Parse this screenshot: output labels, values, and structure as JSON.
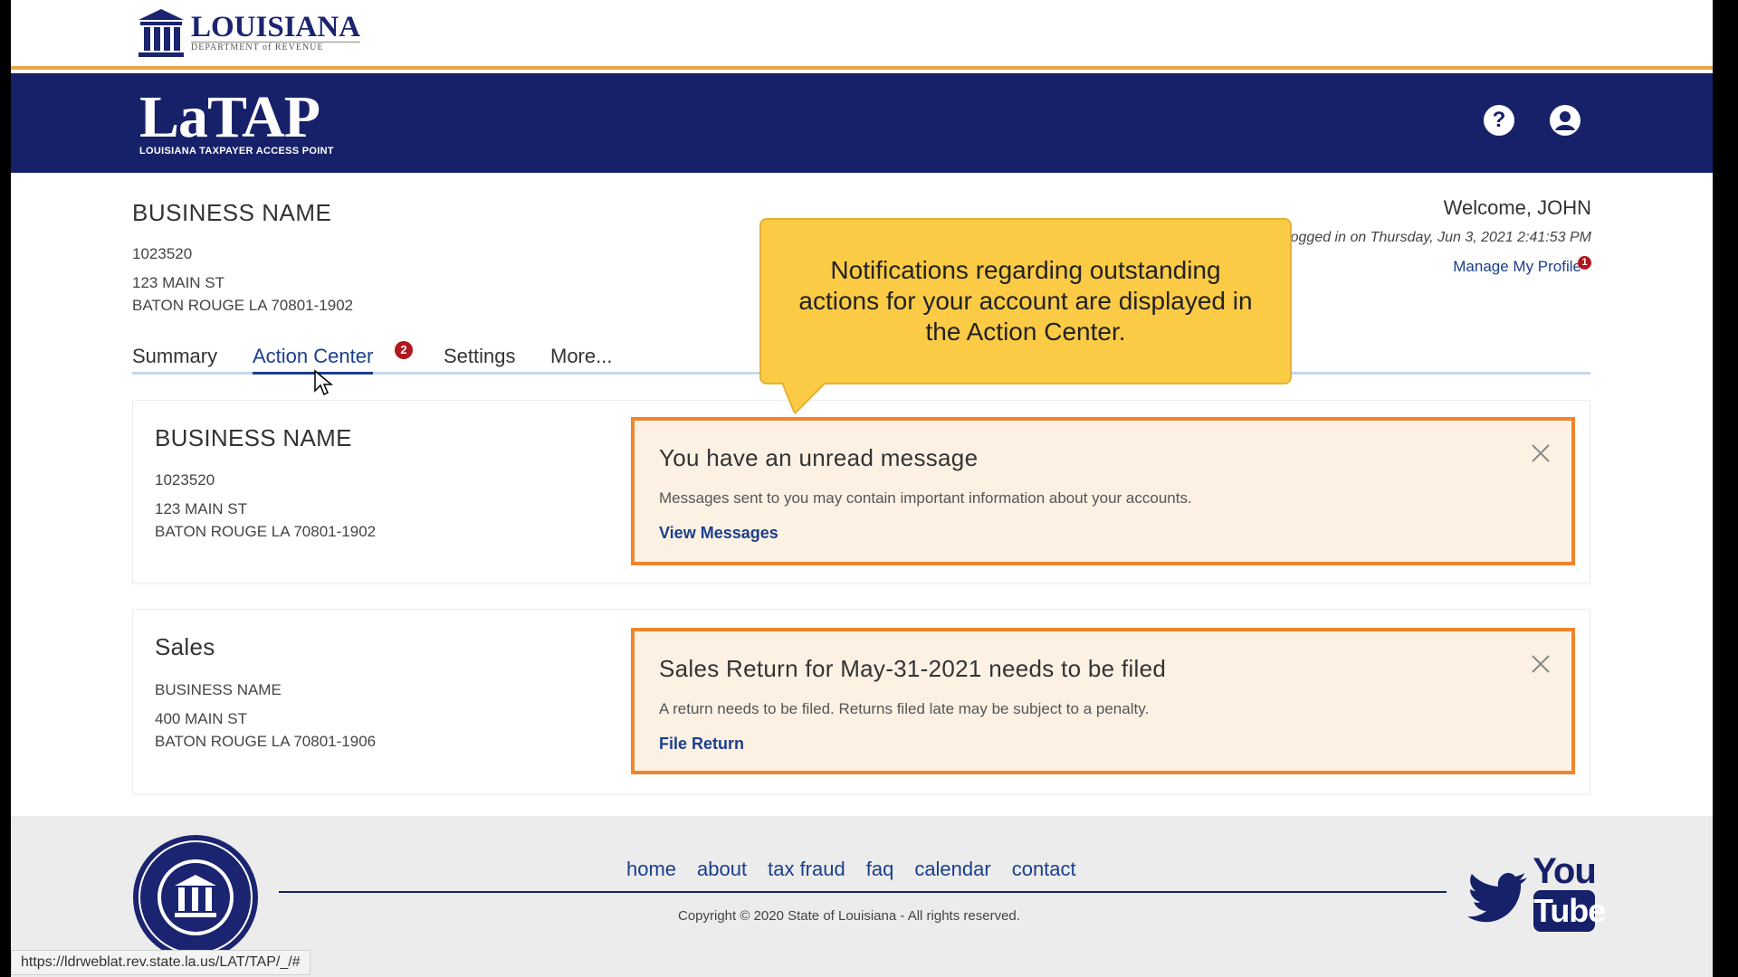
{
  "brand": {
    "dept_logo_word": "LOUISIANA",
    "dept_logo_sub": "DEPARTMENT of REVENUE",
    "app_logo": "LaTAP",
    "app_logo_sub": "LOUISIANA TAXPAYER ACCESS POINT",
    "colors": {
      "navy": "#16216a",
      "accent": "#f0852d",
      "callout": "#fbcb45",
      "link": "#1a3f8c",
      "badge": "#b0171f"
    }
  },
  "header": {
    "help_icon": "question-circle-icon",
    "user_icon": "user-circle-icon"
  },
  "business": {
    "name": "BUSINESS NAME",
    "id": "1023520",
    "address1": "123 MAIN ST",
    "address2": "BATON ROUGE LA 70801-1902"
  },
  "welcome": {
    "greeting": "Welcome, JOHN",
    "last_login": "logged in on Thursday, Jun 3, 2021 2:41:53 PM",
    "manage_profile": "Manage My Profile",
    "manage_badge": "1"
  },
  "tabs": [
    {
      "label": "Summary"
    },
    {
      "label": "Action Center",
      "badge": "2"
    },
    {
      "label": "Settings"
    },
    {
      "label": "More..."
    }
  ],
  "callout": {
    "text": "Notifications regarding outstanding actions for your account are displayed in the Action Center."
  },
  "cards": [
    {
      "title": "BUSINESS NAME",
      "line1": "1023520",
      "line2": "123 MAIN ST",
      "line3": "BATON ROUGE LA 70801-1902",
      "notice": {
        "title": "You have an unread message",
        "text": "Messages sent to you may contain important information about your accounts.",
        "link": "View Messages"
      }
    },
    {
      "title": "Sales",
      "line1": "BUSINESS NAME",
      "line2": "400 MAIN ST",
      "line3": "BATON ROUGE LA 70801-1906",
      "notice": {
        "title": "Sales Return for May-31-2021 needs to be filed",
        "text": "A return needs to be filed. Returns filed late may be subject to a penalty.",
        "link": "File Return"
      }
    }
  ],
  "footer": {
    "links": [
      "home",
      "about",
      "tax fraud",
      "faq",
      "calendar",
      "contact"
    ],
    "copyright": "Copyright © 2020 State of Louisiana - All rights reserved.",
    "youtube_you": "You",
    "youtube_tube": "Tube"
  },
  "status_url": "https://ldrweblat.rev.state.la.us/LAT/TAP/_/#"
}
